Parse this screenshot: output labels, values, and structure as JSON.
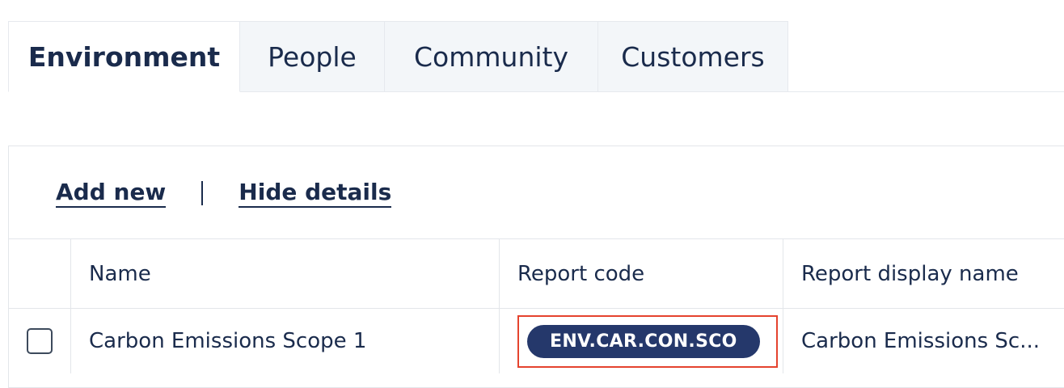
{
  "tabs": [
    {
      "label": "Environment",
      "active": true
    },
    {
      "label": "People",
      "active": false
    },
    {
      "label": "Community",
      "active": false
    },
    {
      "label": "Customers",
      "active": false
    }
  ],
  "actions": {
    "add_new": "Add new",
    "hide_details": "Hide details"
  },
  "table": {
    "columns": [
      "Name",
      "Report code",
      "Report display name"
    ],
    "rows": [
      {
        "checked": false,
        "name": "Carbon Emissions Scope 1",
        "report_code": "ENV.CAR.CON.SCO",
        "report_display_name": "Carbon Emissions Sc..."
      }
    ]
  },
  "colors": {
    "text": "#1a2b4c",
    "pill_bg": "#25386b",
    "highlight_border": "#e5432e",
    "inactive_tab_bg": "#f3f6f9"
  }
}
